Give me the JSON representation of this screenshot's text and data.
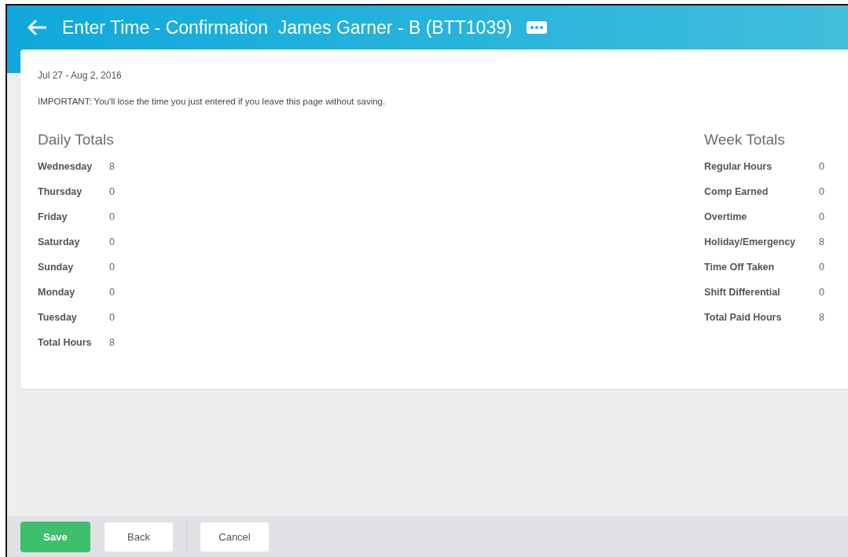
{
  "header": {
    "title": "Enter Time - Confirmation  James Garner - B (BTT1039)"
  },
  "period": "Jul 27 - Aug 2, 2016",
  "warning": "IMPORTANT: You'll lose the time you just entered if you leave this page without saving.",
  "daily_totals": {
    "title": "Daily Totals",
    "rows": [
      {
        "label": "Wednesday",
        "value": "8"
      },
      {
        "label": "Thursday",
        "value": "0"
      },
      {
        "label": "Friday",
        "value": "0"
      },
      {
        "label": "Saturday",
        "value": "0"
      },
      {
        "label": "Sunday",
        "value": "0"
      },
      {
        "label": "Monday",
        "value": "0"
      },
      {
        "label": "Tuesday",
        "value": "0"
      },
      {
        "label": "Total Hours",
        "value": "8"
      }
    ]
  },
  "week_totals": {
    "title": "Week Totals",
    "rows": [
      {
        "label": "Regular Hours",
        "value": "0"
      },
      {
        "label": "Comp Earned",
        "value": "0"
      },
      {
        "label": "Overtime",
        "value": "0"
      },
      {
        "label": "Holiday/Emergency",
        "value": "8"
      },
      {
        "label": "Time Off Taken",
        "value": "0"
      },
      {
        "label": "Shift Differential",
        "value": "0"
      },
      {
        "label": "Total Paid Hours",
        "value": "8"
      }
    ]
  },
  "buttons": [
    {
      "label": "Save",
      "kind": "primary"
    },
    {
      "label": "Back",
      "kind": "secondary"
    },
    {
      "label": "Cancel",
      "kind": "secondary"
    }
  ]
}
